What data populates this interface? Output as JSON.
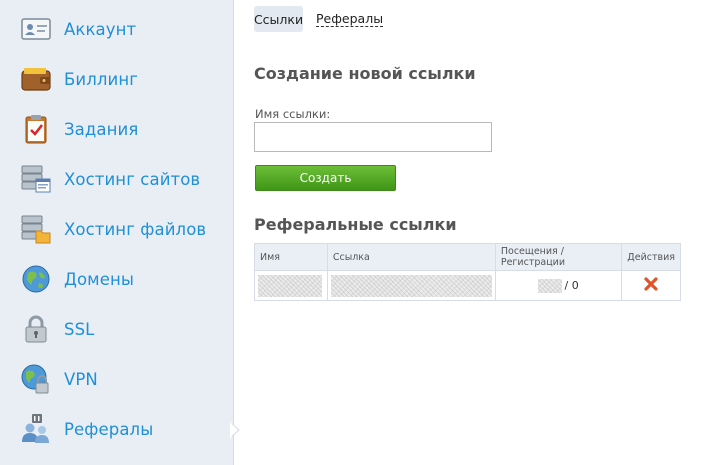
{
  "sidebar": {
    "items": [
      {
        "label": "Аккаунт",
        "icon": "account-card-icon"
      },
      {
        "label": "Биллинг",
        "icon": "wallet-icon"
      },
      {
        "label": "Задания",
        "icon": "clipboard-check-icon"
      },
      {
        "label": "Хостинг сайтов",
        "icon": "server-web-icon"
      },
      {
        "label": "Хостинг файлов",
        "icon": "server-folder-icon"
      },
      {
        "label": "Домены",
        "icon": "globe-icon"
      },
      {
        "label": "SSL",
        "icon": "padlock-icon"
      },
      {
        "label": "VPN",
        "icon": "globe-lock-icon"
      },
      {
        "label": "Рефералы",
        "icon": "users-icon"
      }
    ],
    "active": "Рефералы"
  },
  "tabs": [
    {
      "label": "Ссылки",
      "active": true
    },
    {
      "label": "Рефералы",
      "active": false
    }
  ],
  "create": {
    "title": "Создание новой ссылки",
    "name_label": "Имя ссылки:",
    "name_value": "",
    "button": "Создать"
  },
  "referrals": {
    "title": "Реферальные ссылки",
    "columns": [
      "Имя",
      "Ссылка",
      "Посещения / Регистрации",
      "Действия"
    ],
    "rows": [
      {
        "name": "",
        "link": "",
        "visits": "",
        "separator": "/",
        "registrations": "0"
      }
    ]
  },
  "colors": {
    "accent": "#1f8fd8",
    "button": "#4ea523",
    "delete": "#e0522a"
  }
}
